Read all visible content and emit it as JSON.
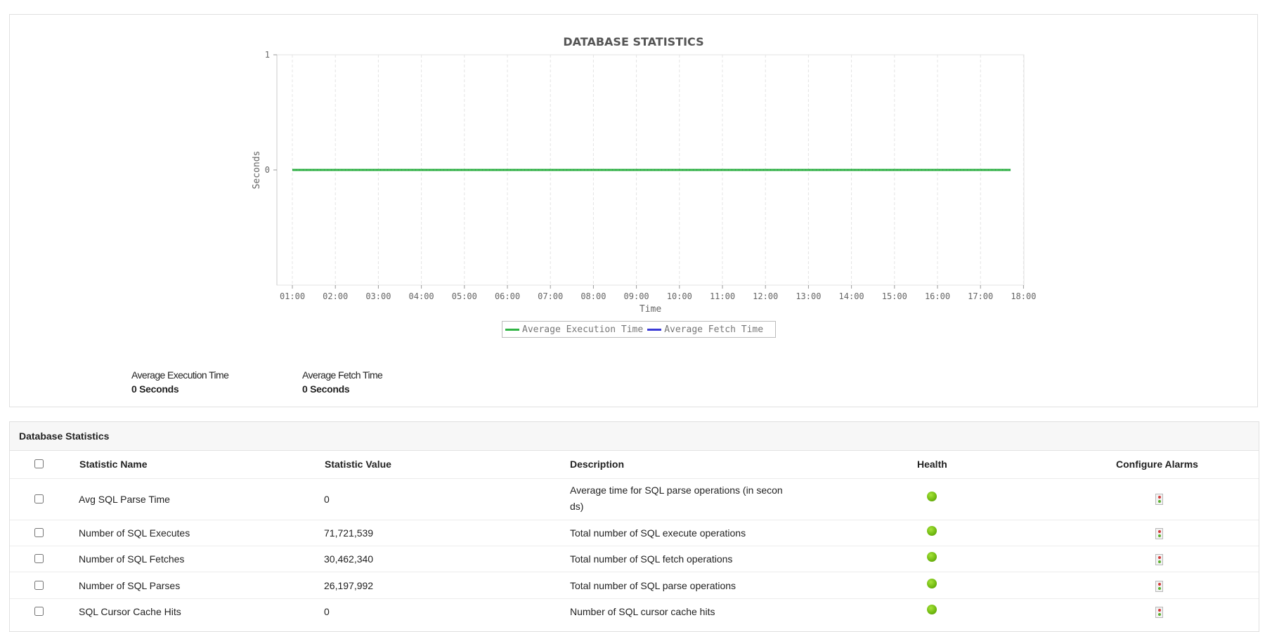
{
  "chart_panel": {
    "title": "DATABASE STATISTICS",
    "summary": [
      {
        "label": "Average Execution Time",
        "value": "0 Seconds"
      },
      {
        "label": "Average Fetch Time",
        "value": "0 Seconds"
      }
    ]
  },
  "chart_data": {
    "type": "line",
    "title": "DATABASE STATISTICS",
    "xlabel": "Time",
    "ylabel": "Seconds",
    "x": [
      "01:00",
      "02:00",
      "03:00",
      "04:00",
      "05:00",
      "06:00",
      "07:00",
      "08:00",
      "09:00",
      "10:00",
      "11:00",
      "12:00",
      "13:00",
      "14:00",
      "15:00",
      "16:00",
      "17:00",
      "18:00"
    ],
    "x_range_hours": [
      1,
      17.7
    ],
    "ylim": [
      -1,
      1
    ],
    "yticks": [
      0,
      1
    ],
    "grid": "vertical dashed",
    "legend_position": "bottom-center",
    "series": [
      {
        "name": "Average Execution Time",
        "color": "#2fb344",
        "x": [
          1,
          17.7
        ],
        "values": [
          0,
          0
        ]
      },
      {
        "name": "Average Fetch Time",
        "color": "#3a3ad6",
        "x": [
          1,
          17.7
        ],
        "values": [
          0,
          0
        ]
      }
    ]
  },
  "table": {
    "title": "Database Statistics",
    "columns": [
      "Statistic Name",
      "Statistic Value",
      "Description",
      "Health",
      "Configure Alarms"
    ],
    "rows": [
      {
        "name": "Avg SQL Parse Time",
        "value": "0",
        "description": "Average time for SQL parse operations (in secon",
        "description_line2": "ds)",
        "health": "green"
      },
      {
        "name": "Number of SQL Executes",
        "value": "71,721,539",
        "description": "Total number of SQL execute operations",
        "description_line2": "",
        "health": "green"
      },
      {
        "name": "Number of SQL Fetches",
        "value": "30,462,340",
        "description": "Total number of SQL fetch operations",
        "description_line2": "",
        "health": "green"
      },
      {
        "name": "Number of SQL Parses",
        "value": "26,197,992",
        "description": "Total number of SQL parse operations",
        "description_line2": "",
        "health": "green"
      },
      {
        "name": "SQL Cursor Cache Hits",
        "value": "0",
        "description": "Number of SQL cursor cache hits",
        "description_line2": "",
        "health": "green"
      }
    ]
  },
  "icons": {
    "health": "green-status-dot-icon",
    "alarm": "traffic-light-alarm-icon"
  }
}
